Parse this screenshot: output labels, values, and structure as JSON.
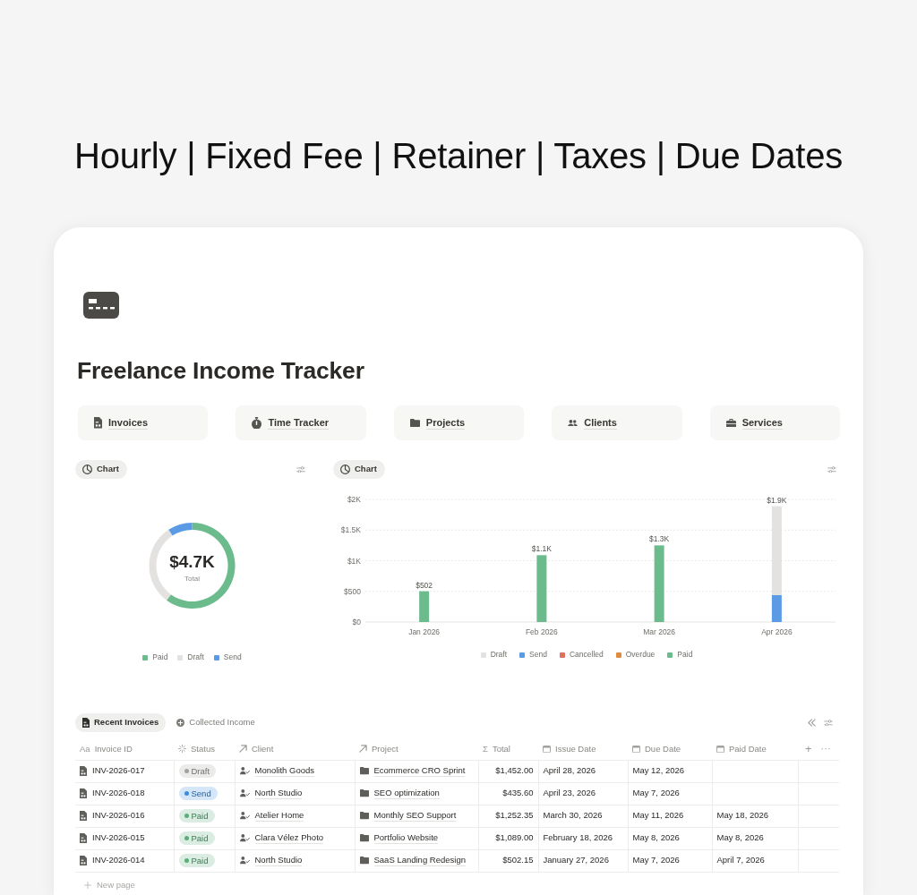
{
  "headline": "Hourly | Fixed Fee | Retainer | Taxes | Due Dates",
  "page": {
    "title": "Freelance Income Tracker"
  },
  "nav_buttons": [
    {
      "label": "Invoices",
      "kind": "invoice"
    },
    {
      "label": "Time Tracker",
      "kind": "timer"
    },
    {
      "label": "Projects",
      "kind": "folder"
    },
    {
      "label": "Clients",
      "kind": "people"
    },
    {
      "label": "Services",
      "kind": "briefcase"
    }
  ],
  "charts": [
    {
      "view_label": "Chart",
      "center_value": "$4.7K",
      "center_label": "Total",
      "slices": [
        {
          "color": "#6cbb8d"
        },
        {
          "color": "#e3e2e0"
        },
        {
          "color": "#5b9be6"
        }
      ],
      "chart_data": {
        "type": "donut",
        "categories": [
          "Paid",
          "Draft",
          "Send"
        ],
        "values": [
          60.1,
          30.7,
          9.2
        ],
        "legend": "bottom"
      }
    },
    {
      "view_label": "Chart",
      "chart_data": {
        "type": "bar",
        "categories": [
          "Jan 2026",
          "Feb 2026",
          "Mar 2026",
          "Apr 2026"
        ],
        "series": [
          {
            "name": "Draft",
            "color": "#e3e2e0",
            "values": [
              null,
              null,
              null,
              1450
            ]
          },
          {
            "name": "Send",
            "color": "#5b9be6",
            "values": [
              null,
              null,
              null,
              440
            ]
          },
          {
            "name": "Cancelled",
            "color": "#e16f5f",
            "values": [
              null,
              null,
              null,
              null
            ]
          },
          {
            "name": "Overdue",
            "color": "#df8c3d",
            "values": [
              null,
              null,
              null,
              null
            ]
          },
          {
            "name": "Paid",
            "color": "#6cbb8d",
            "values": [
              502,
              1090,
              1250,
              null
            ]
          }
        ],
        "stacked": true,
        "grid": true,
        "legend": "bottom",
        "ylim": [
          0,
          2000
        ],
        "yticks": [
          {
            "value": 0,
            "label": "$0"
          },
          {
            "value": 500,
            "label": "$500"
          },
          {
            "value": 1000,
            "label": "$1K"
          },
          {
            "value": 1500,
            "label": "$1.5K"
          },
          {
            "value": 2000,
            "label": "$2K"
          }
        ],
        "value_labels": [
          "$502",
          "$1.1K",
          "$1.3K",
          "$1.9K"
        ]
      }
    }
  ],
  "table_tabs": [
    {
      "label": "Recent Invoices",
      "kind": "table",
      "selected": true
    },
    {
      "label": "Collected Income",
      "kind": "add",
      "selected": false
    }
  ],
  "table": {
    "columns": [
      {
        "label": "Invoice ID",
        "kind": "title",
        "glyph": "Aa"
      },
      {
        "label": "Status",
        "kind": "status"
      },
      {
        "label": "Client",
        "kind": "client"
      },
      {
        "label": "Project",
        "kind": "project"
      },
      {
        "label": "Total",
        "kind": "number",
        "glyph": "Σ"
      },
      {
        "label": "Issue Date",
        "kind": "date"
      },
      {
        "label": "Due Date",
        "kind": "date"
      },
      {
        "label": "Paid Date",
        "kind": "date"
      }
    ],
    "header_actions": [
      {
        "kind": "add",
        "text": "+"
      },
      {
        "kind": "more",
        "text": "···"
      }
    ],
    "rows": [
      {
        "invoice_id": "INV-2026-017",
        "status": {
          "label": "Draft",
          "color": "#a3a29e"
        },
        "client": "Monolith Goods",
        "project": "Ecommerce CRO Sprint",
        "total": "$1,452.00",
        "issue_date": "April 28, 2026",
        "due_date": "May 12, 2026"
      },
      {
        "invoice_id": "INV-2026-018",
        "status": {
          "label": "Send",
          "color": "#3b8ce0"
        },
        "client": "North Studio",
        "project": "SEO optimization",
        "total": "$435.60",
        "issue_date": "April 23, 2026",
        "due_date": "May 7, 2026"
      },
      {
        "invoice_id": "INV-2026-016",
        "status": {
          "label": "Paid",
          "color": "#5cad7b"
        },
        "client": "Atelier Home",
        "project": "Monthly SEO Support",
        "total": "$1,252.35",
        "issue_date": "March 30, 2026",
        "due_date": "May 11, 2026",
        "paid_date": "May 18, 2026"
      },
      {
        "invoice_id": "INV-2026-015",
        "status": {
          "label": "Paid",
          "color": "#5cad7b"
        },
        "client": "Clara Vélez Photo",
        "project": "Portfolio Website",
        "total": "$1,089.00",
        "issue_date": "February 18, 2026",
        "due_date": "May 8, 2026",
        "paid_date": "May 8, 2026"
      },
      {
        "invoice_id": "INV-2026-014",
        "status": {
          "label": "Paid",
          "color": "#5cad7b"
        },
        "client": "North Studio",
        "project": "SaaS Landing Redesign",
        "total": "$502.15",
        "issue_date": "January 27, 2026",
        "due_date": "May 7, 2026",
        "paid_date": "April 7, 2026"
      }
    ],
    "new_page_label": "New page"
  }
}
